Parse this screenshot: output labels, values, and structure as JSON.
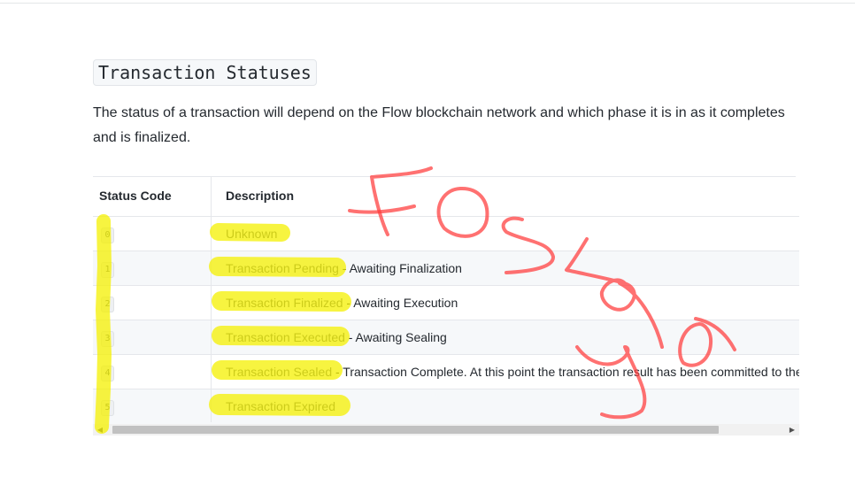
{
  "section": {
    "heading": "Transaction Statuses",
    "intro_line1": "The status of a transaction will depend on the Flow blockchain network and which phase it is in as it completes",
    "intro_line2": "and is finalized."
  },
  "table": {
    "headers": [
      "Status Code",
      "Description"
    ],
    "rows": [
      {
        "code": "0",
        "status": "Unknown",
        "rest": ""
      },
      {
        "code": "1",
        "status": "Transaction Pending",
        "rest": " - Awaiting Finalization"
      },
      {
        "code": "2",
        "status": "Transaction Finalized",
        "rest": " - Awaiting Execution"
      },
      {
        "code": "3",
        "status": "Transaction Executed",
        "rest": " - Awaiting Sealing"
      },
      {
        "code": "4",
        "status": "Transaction Sealed",
        "rest": " - Transaction Complete. At this point the transaction result has been committed to the"
      },
      {
        "code": "5",
        "status": "Transaction Expired",
        "rest": ""
      }
    ]
  },
  "scrollbar": {
    "left_icon": "arrow-left-icon",
    "right_icon": "arrow-right-icon"
  },
  "annotations": {
    "highlight_color": "#f4f000",
    "ink_color": "#ff3a3a"
  }
}
